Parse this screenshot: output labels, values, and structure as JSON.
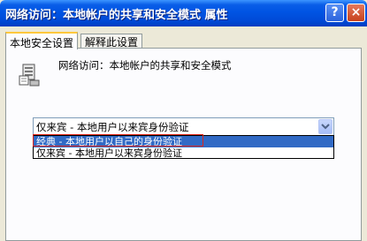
{
  "window": {
    "title": "网络访问：本地帐户的共享和安全模式 属性",
    "help_button": "?",
    "close_button": "×"
  },
  "tabs": [
    {
      "label": "本地安全设置",
      "active": true
    },
    {
      "label": "解释此设置",
      "active": false
    }
  ],
  "policy": {
    "icon": "policy-server-icon",
    "description": "网络访问：本地帐户的共享和安全模式"
  },
  "combo": {
    "selected": "仅来宾 - 本地用户以来宾身份验证",
    "arrow_icon": "chevron-down-icon",
    "options": [
      "经典 - 本地用户以自己的身份验证",
      "仅来宾 - 本地用户以来宾身份验证"
    ],
    "highlighted_index": 0
  },
  "colors": {
    "titlebar": "#0054e3",
    "selection": "#316ac5",
    "annotation_box": "#e0261b",
    "tab_active_accent": "#ffc83c"
  }
}
